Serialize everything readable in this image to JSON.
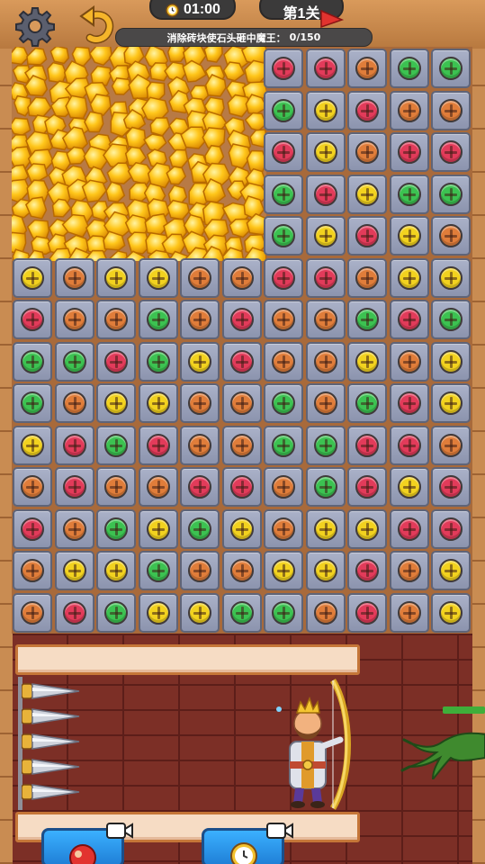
{
  "hud": {
    "timer": "01:00",
    "level": "第1关",
    "goal_text": "消除砖块使石头砸中魔王：",
    "goal_progress": "0/150"
  },
  "icons": {
    "settings": "gear-icon",
    "undo": "undo-arrow-icon",
    "timer": "alarm-clock-icon",
    "level": "red-flag-icon",
    "tool_left": "bomb-bag-icon",
    "tool_right": "alarm-clock-icon",
    "video": "video-camera-icon"
  },
  "colors": {
    "red": "#e23b5a",
    "orange": "#e07d3a",
    "yellow": "#f2d21f",
    "green": "#3cc251"
  },
  "board": {
    "rows_top": [
      [
        "red",
        "red",
        "orange",
        "green",
        "green"
      ],
      [
        "green",
        "yellow",
        "red",
        "orange",
        "orange"
      ],
      [
        "red",
        "yellow",
        "orange",
        "red",
        "red"
      ],
      [
        "green",
        "red",
        "yellow",
        "green",
        "green"
      ],
      [
        "green",
        "yellow",
        "red",
        "yellow",
        "orange"
      ]
    ],
    "rows_full": [
      [
        "yellow",
        "orange",
        "yellow",
        "yellow",
        "orange",
        "orange",
        "red",
        "red",
        "orange",
        "yellow",
        "yellow"
      ],
      [
        "red",
        "orange",
        "orange",
        "green",
        "orange",
        "red",
        "orange",
        "orange",
        "green",
        "red",
        "green"
      ],
      [
        "green",
        "green",
        "red",
        "green",
        "yellow",
        "red",
        "orange",
        "orange",
        "yellow",
        "orange",
        "yellow"
      ],
      [
        "green",
        "orange",
        "yellow",
        "yellow",
        "orange",
        "orange",
        "green",
        "orange",
        "green",
        "red",
        "yellow"
      ],
      [
        "yellow",
        "red",
        "green",
        "red",
        "orange",
        "orange",
        "green",
        "green",
        "red",
        "red",
        "orange"
      ],
      [
        "orange",
        "red",
        "orange",
        "orange",
        "red",
        "red",
        "orange",
        "green",
        "red",
        "yellow",
        "red"
      ],
      [
        "red",
        "orange",
        "green",
        "yellow",
        "green",
        "yellow",
        "orange",
        "yellow",
        "yellow",
        "red",
        "red"
      ],
      [
        "orange",
        "yellow",
        "yellow",
        "green",
        "orange",
        "orange",
        "yellow",
        "yellow",
        "red",
        "orange",
        "yellow"
      ],
      [
        "orange",
        "red",
        "green",
        "yellow",
        "yellow",
        "green",
        "green",
        "orange",
        "red",
        "orange",
        "yellow"
      ]
    ]
  },
  "enemy": {
    "health_fraction": 1.0
  }
}
